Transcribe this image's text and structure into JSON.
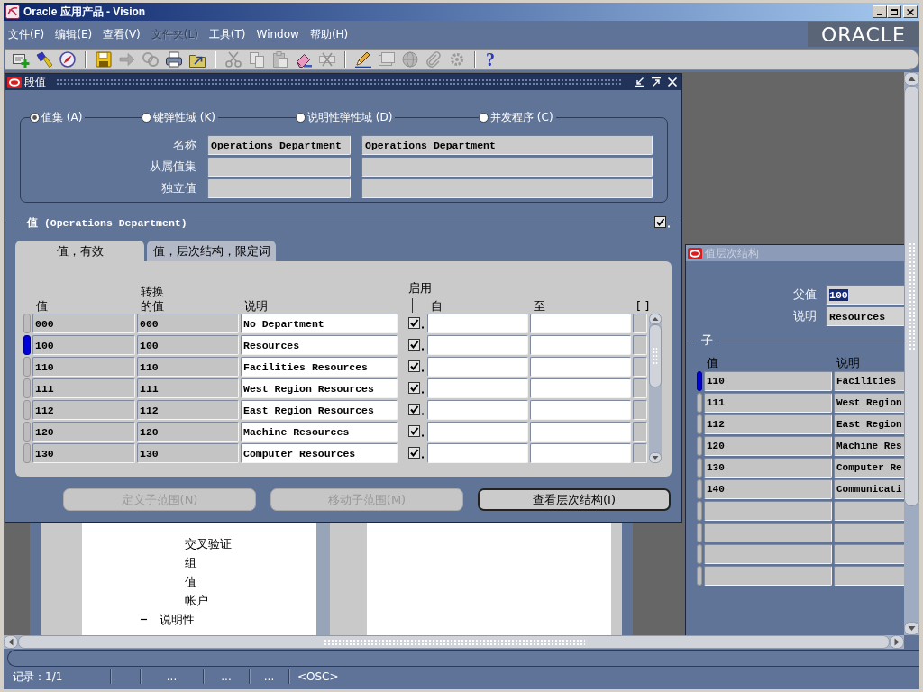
{
  "window": {
    "title": "Oracle 应用产品 - Vision"
  },
  "menu": [
    {
      "label": "文件(F)",
      "disabled": false
    },
    {
      "label": "编辑(E)",
      "disabled": false
    },
    {
      "label": "查看(V)",
      "disabled": false
    },
    {
      "label": "文件夹(L)",
      "disabled": true
    },
    {
      "label": "工具(T)",
      "disabled": false
    },
    {
      "label": "Window",
      "disabled": false
    },
    {
      "label": "帮助(H)",
      "disabled": false
    }
  ],
  "logo": "ORACLE",
  "toolbar": [
    {
      "kind": "new",
      "disabled": false
    },
    {
      "kind": "find",
      "disabled": false
    },
    {
      "kind": "navigator",
      "disabled": false
    },
    {
      "kind": "separator"
    },
    {
      "kind": "save",
      "disabled": false
    },
    {
      "kind": "next",
      "disabled": true
    },
    {
      "kind": "switch",
      "disabled": true
    },
    {
      "kind": "print",
      "disabled": false
    },
    {
      "kind": "close",
      "disabled": false
    },
    {
      "kind": "separator"
    },
    {
      "kind": "cut",
      "disabled": true
    },
    {
      "kind": "copy",
      "disabled": true
    },
    {
      "kind": "paste",
      "disabled": true
    },
    {
      "kind": "clear",
      "disabled": false
    },
    {
      "kind": "delete",
      "disabled": true
    },
    {
      "kind": "separator"
    },
    {
      "kind": "edit",
      "disabled": false
    },
    {
      "kind": "zoom",
      "disabled": true
    },
    {
      "kind": "translate",
      "disabled": true
    },
    {
      "kind": "attach",
      "disabled": true
    },
    {
      "kind": "tools",
      "disabled": true
    },
    {
      "kind": "separator"
    },
    {
      "kind": "help",
      "glyph": "?",
      "disabled": false
    }
  ],
  "segment_values": {
    "title": "段值",
    "active": true,
    "radios": [
      {
        "label": "值集 (A)",
        "selected": true
      },
      {
        "label": "键弹性域 (K)",
        "selected": false
      },
      {
        "label": "说明性弹性域 (D)",
        "selected": false
      },
      {
        "label": "并发程序 (C)",
        "selected": false
      }
    ],
    "fields": [
      {
        "label": "名称",
        "value": "Operations Department",
        "description": "Operations Department"
      },
      {
        "label": "从属值集"
      },
      {
        "label": "独立值"
      }
    ],
    "values_section": {
      "title": "值 (Operations Department)",
      "checked": true
    },
    "tabs": [
      {
        "label": "值，有效",
        "selected": true
      },
      {
        "label": "值，层次结构，限定词",
        "selected": false
      }
    ],
    "table": {
      "columns": [
        "值",
        "转换的值",
        "说明",
        "启用",
        "自",
        "至",
        "[ ]"
      ],
      "rows": [
        {
          "value": "000",
          "translated": "000",
          "description": "No Department",
          "enabled": true,
          "selected": false
        },
        {
          "value": "100",
          "translated": "100",
          "description": "Resources",
          "enabled": true,
          "selected": true
        },
        {
          "value": "110",
          "translated": "110",
          "description": "Facilities Resources",
          "enabled": true,
          "selected": false
        },
        {
          "value": "111",
          "translated": "111",
          "description": "West Region Resources",
          "enabled": true,
          "selected": false
        },
        {
          "value": "112",
          "translated": "112",
          "description": "East Region Resources",
          "enabled": true,
          "selected": false
        },
        {
          "value": "120",
          "translated": "120",
          "description": "Machine Resources",
          "enabled": true,
          "selected": false
        },
        {
          "value": "130",
          "translated": "130",
          "description": "Computer Resources",
          "enabled": true,
          "selected": false
        }
      ]
    },
    "buttons": [
      {
        "label": "定义子范围(N)",
        "disabled": true
      },
      {
        "label": "移动子范围(M)",
        "disabled": true
      },
      {
        "label": "查看层次结构(I)",
        "disabled": false
      }
    ]
  },
  "value_hierarchy": {
    "title": "值层次结构",
    "active": false,
    "parent_value": {
      "label": "父值",
      "value": "100",
      "highlighted": true
    },
    "description": {
      "label": "说明",
      "value": "Resources"
    },
    "children_section": "子",
    "columns": [
      "值",
      "说明"
    ],
    "rows": [
      {
        "value": "110",
        "description": "Facilities",
        "selected": true
      },
      {
        "value": "111",
        "description": "West Region",
        "selected": false
      },
      {
        "value": "112",
        "description": "East Region",
        "selected": false
      },
      {
        "value": "120",
        "description": "Machine Res",
        "selected": false
      },
      {
        "value": "130",
        "description": "Computer Re",
        "selected": false
      },
      {
        "value": "140",
        "description": "Communicati",
        "selected": false
      }
    ]
  },
  "background_form": {
    "tree": [
      {
        "children": [
          {
            "label": "交叉验证"
          },
          {
            "label": "组"
          },
          {
            "label": "值"
          },
          {
            "label": "帐户"
          }
        ]
      },
      {
        "label": "说明性",
        "expanded": true
      }
    ]
  },
  "status_bar": {
    "record": "记录：1/1",
    "fields": [
      "...",
      "...",
      "..."
    ],
    "mode": "<OSC>"
  }
}
